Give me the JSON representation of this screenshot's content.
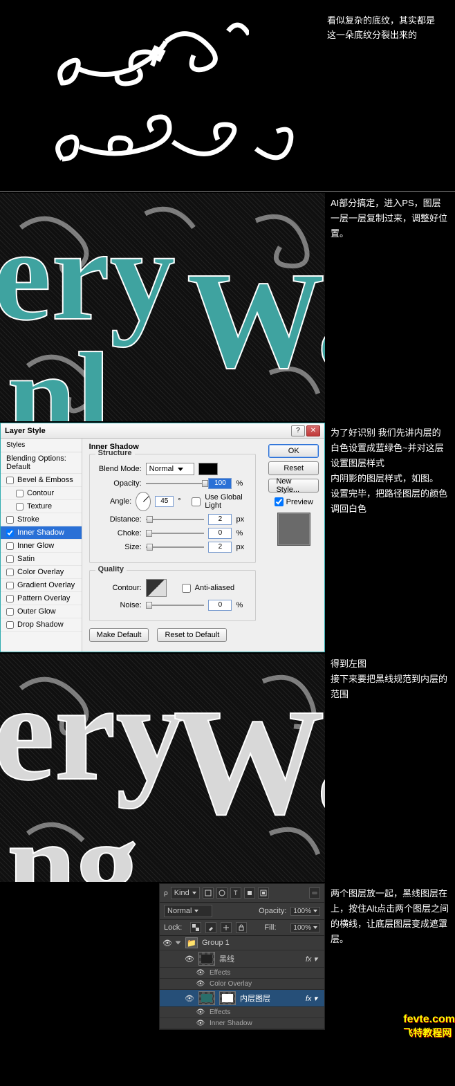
{
  "intro": {
    "text1": "看似复杂的底纹，其实都是这一朵底纹分裂出来的"
  },
  "section1": {
    "text": "AI部分搞定，进入PS，图层一层一层复制过来，调整好位置。"
  },
  "section2": {
    "line1": "为了好识别 我们先讲内层的白色设置成蓝绿色~并对这层设置图层样式",
    "line2": "内阴影的图层样式，如图。",
    "line3": "设置完毕，把路径图层的颜色调回白色"
  },
  "section3": {
    "line1": "得到左图",
    "line2": "接下来要把黑线规范到内层的范围"
  },
  "section4": {
    "text": "两个图层放一起，黑线图层在上，按住Alt点击两个图层之间的横线，让底层图层变成遮罩层。"
  },
  "dialog": {
    "title": "Layer Style",
    "sidebar_title": "Styles",
    "styles": {
      "blending": "Blending Options: Default",
      "bevel": "Bevel & Emboss",
      "contour": "Contour",
      "texture": "Texture",
      "stroke": "Stroke",
      "inner_shadow": "Inner Shadow",
      "inner_glow": "Inner Glow",
      "satin": "Satin",
      "color_overlay": "Color Overlay",
      "gradient_overlay": "Gradient Overlay",
      "pattern_overlay": "Pattern Overlay",
      "outer_glow": "Outer Glow",
      "drop_shadow": "Drop Shadow"
    },
    "structure_title": "Inner Shadow",
    "group_structure": "Structure",
    "group_quality": "Quality",
    "labels": {
      "blend_mode": "Blend Mode:",
      "opacity": "Opacity:",
      "angle": "Angle:",
      "global_light": "Use Global Light",
      "distance": "Distance:",
      "choke": "Choke:",
      "size": "Size:",
      "contour": "Contour:",
      "antialiased": "Anti-aliased",
      "noise": "Noise:",
      "make_default": "Make Default",
      "reset_default": "Reset to Default"
    },
    "values": {
      "blend_mode": "Normal",
      "opacity": "100",
      "angle": "45",
      "distance": "2",
      "choke": "0",
      "size": "2",
      "noise": "0"
    },
    "units": {
      "pct": "%",
      "px": "px",
      "deg": "°"
    },
    "buttons": {
      "ok": "OK",
      "reset": "Reset",
      "new_style": "New Style...",
      "preview": "Preview"
    }
  },
  "layers": {
    "kind_label": "Kind",
    "blend_mode": "Normal",
    "opacity_label": "Opacity:",
    "opacity_val": "100%",
    "lock_label": "Lock:",
    "fill_label": "Fill:",
    "fill_val": "100%",
    "group": "Group 1",
    "layer_blackline": "黑线",
    "effects": "Effects",
    "fx_color_overlay": "Color Overlay",
    "layer_inner": "内层图层",
    "fx_inner_shadow": "Inner Shadow"
  },
  "watermark": {
    "site1": "fevte.com",
    "site2": "飞特教程网"
  }
}
